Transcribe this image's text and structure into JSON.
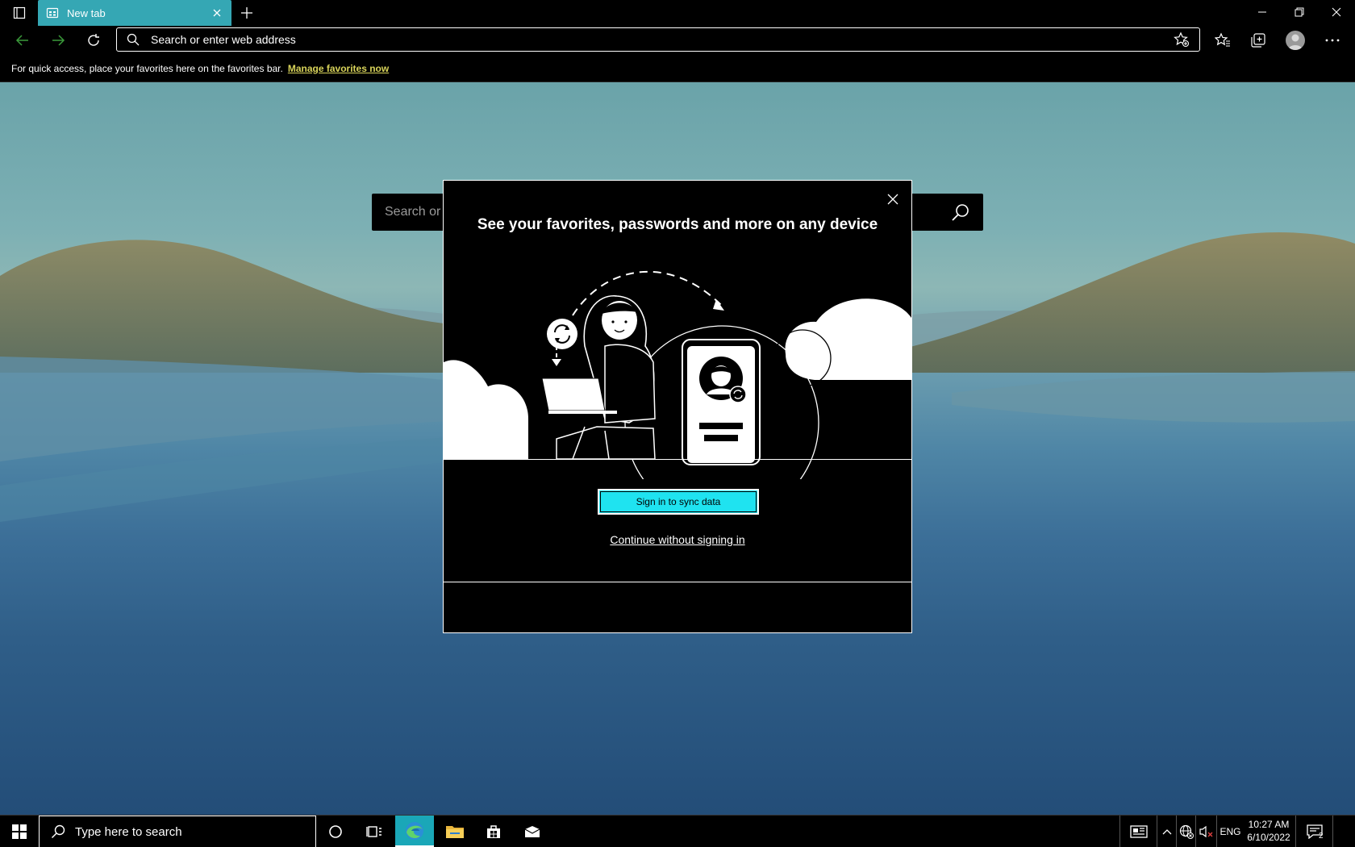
{
  "browser": {
    "tab": {
      "title": "New tab"
    },
    "address_bar": {
      "placeholder": "Search or enter web address"
    },
    "favorites_bar": {
      "message": "For quick access, place your favorites here on the favorites bar.",
      "link": "Manage favorites now"
    }
  },
  "ntp": {
    "search_placeholder": "Search or"
  },
  "dialog": {
    "title": "See your favorites, passwords and more on any device",
    "primary_button": "Sign in to sync data",
    "secondary_link": "Continue without signing in"
  },
  "taskbar": {
    "search_placeholder": "Type here to search",
    "language": "ENG",
    "time": "10:27 AM",
    "date": "6/10/2022",
    "notification_count": "2"
  },
  "colors": {
    "tab_active": "#35a7b4",
    "primary_button": "#1fe3f0",
    "link": "#d8d35a",
    "taskbar_active": "#1aa7b8"
  }
}
